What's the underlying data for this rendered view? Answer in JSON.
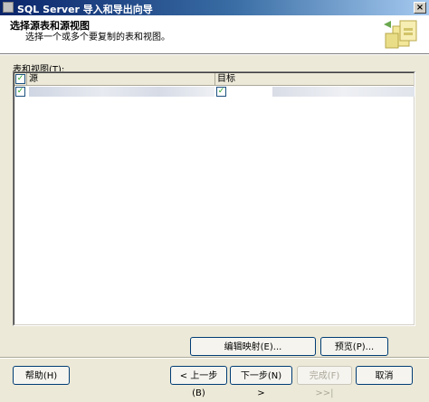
{
  "window": {
    "title": "SQL Server 导入和导出向导",
    "close_glyph": "×"
  },
  "header": {
    "heading": "选择源表和源视图",
    "subheading": "选择一个或多个要复制的表和视图。"
  },
  "list": {
    "label": "表和视图(T):",
    "columns": {
      "source": "源",
      "target": "目标"
    },
    "rows": [
      {
        "checked": true,
        "target_checked": true
      }
    ],
    "check_glyph": "✓"
  },
  "buttons": {
    "edit_mapping": "编辑映射(E)...",
    "preview": "预览(P)...",
    "help": "帮助(H)",
    "back": "< 上一步(B)",
    "next": "下一步(N) >",
    "finish": "完成(F) >>|",
    "cancel": "取消"
  },
  "colors": {
    "titlebar_start": "#0a246a",
    "titlebar_end": "#a6caf0",
    "dialog_bg": "#ece9d8",
    "button_border": "#003c74"
  }
}
